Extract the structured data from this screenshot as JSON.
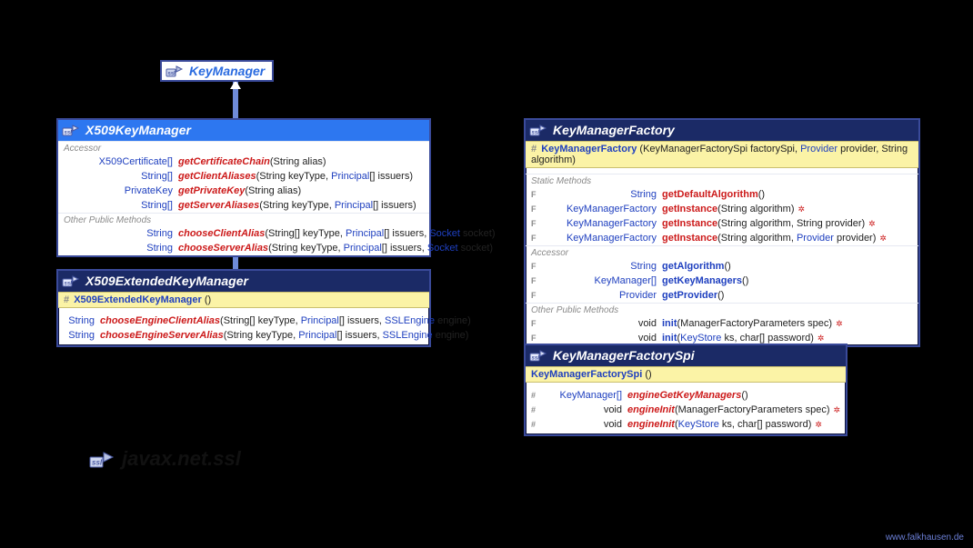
{
  "package": "javax.net.ssl",
  "credit": "www.falkhausen.de",
  "keyManager": {
    "title": "KeyManager"
  },
  "x509KM": {
    "title": "X509KeyManager",
    "sections": {
      "accessor": "Accessor",
      "other": "Other Public Methods"
    },
    "rows": [
      {
        "ret": "X509Certificate[]",
        "name": "getCertificateChain",
        "params": "(String alias)",
        "style": "red"
      },
      {
        "ret": "String[]",
        "name": "getClientAliases",
        "params": "(String keyType, Principal[] issuers)",
        "style": "red",
        "types": [
          "Principal"
        ]
      },
      {
        "ret": "PrivateKey",
        "name": "getPrivateKey",
        "params": "(String alias)",
        "style": "red"
      },
      {
        "ret": "String[]",
        "name": "getServerAliases",
        "params": "(String keyType, Principal[] issuers)",
        "style": "red",
        "types": [
          "Principal"
        ]
      }
    ],
    "other": [
      {
        "ret": "String",
        "name": "chooseClientAlias",
        "params": "(String[] keyType, Principal[] issuers, Socket socket)",
        "style": "red",
        "types": [
          "Principal",
          "Socket"
        ]
      },
      {
        "ret": "String",
        "name": "chooseServerAlias",
        "params": "(String keyType, Principal[] issuers, Socket socket)",
        "style": "red",
        "types": [
          "Principal",
          "Socket"
        ]
      }
    ]
  },
  "x509EKM": {
    "title": "X509ExtendedKeyManager",
    "ctor": {
      "flag": "#",
      "name": "X509ExtendedKeyManager",
      "params": "()"
    },
    "rows": [
      {
        "ret": "String",
        "name": "chooseEngineClientAlias",
        "params": "(String[] keyType, Principal[] issuers, SSLEngine engine)",
        "style": "red",
        "types": [
          "Principal",
          "SSLEngine"
        ]
      },
      {
        "ret": "String",
        "name": "chooseEngineServerAlias",
        "params": "(String keyType, Principal[] issuers, SSLEngine engine)",
        "style": "red",
        "types": [
          "Principal",
          "SSLEngine"
        ]
      }
    ]
  },
  "kmf": {
    "title": "KeyManagerFactory",
    "ctor": {
      "flag": "#",
      "name": "KeyManagerFactory",
      "params": "(KeyManagerFactorySpi factorySpi, Provider provider, String algorithm)",
      "types": [
        "Provider"
      ]
    },
    "sections": {
      "static": "Static Methods",
      "accessor": "Accessor",
      "other": "Other Public Methods"
    },
    "staticRows": [
      {
        "flag": "F",
        "ret": "String",
        "name": "getDefaultAlgorithm",
        "params": "()",
        "style": "redb"
      },
      {
        "flag": "F",
        "ret": "KeyManagerFactory",
        "name": "getInstance",
        "params": "(String algorithm)",
        "style": "redb",
        "throws": true
      },
      {
        "flag": "F",
        "ret": "KeyManagerFactory",
        "name": "getInstance",
        "params": "(String algorithm, String provider)",
        "style": "redb",
        "throws": true
      },
      {
        "flag": "F",
        "ret": "KeyManagerFactory",
        "name": "getInstance",
        "params": "(String algorithm, Provider provider)",
        "style": "redb",
        "throws": true,
        "types": [
          "Provider"
        ]
      }
    ],
    "accessorRows": [
      {
        "flag": "F",
        "ret": "String",
        "name": "getAlgorithm",
        "params": "()",
        "style": "blue"
      },
      {
        "flag": "F",
        "ret": "KeyManager[]",
        "name": "getKeyManagers",
        "params": "()",
        "style": "blue"
      },
      {
        "flag": "F",
        "ret": "Provider",
        "name": "getProvider",
        "params": "()",
        "style": "blue"
      }
    ],
    "otherRows": [
      {
        "flag": "F",
        "ret": "void",
        "name": "init",
        "params": "(ManagerFactoryParameters spec)",
        "style": "blue",
        "throws": true
      },
      {
        "flag": "F",
        "ret": "void",
        "name": "init",
        "params": "(KeyStore ks, char[] password)",
        "style": "blue",
        "throws": true,
        "types": [
          "KeyStore"
        ]
      }
    ]
  },
  "kmfSpi": {
    "title": "KeyManagerFactorySpi",
    "ctor": {
      "name": "KeyManagerFactorySpi",
      "params": "()"
    },
    "rows": [
      {
        "flag": "#",
        "ret": "KeyManager[]",
        "name": "engineGetKeyManagers",
        "params": "()",
        "style": "red"
      },
      {
        "flag": "#",
        "ret": "void",
        "name": "engineInit",
        "params": "(ManagerFactoryParameters spec)",
        "style": "red",
        "throws": true
      },
      {
        "flag": "#",
        "ret": "void",
        "name": "engineInit",
        "params": "(KeyStore ks, char[] password)",
        "style": "red",
        "throws": true,
        "types": [
          "KeyStore"
        ]
      }
    ]
  }
}
